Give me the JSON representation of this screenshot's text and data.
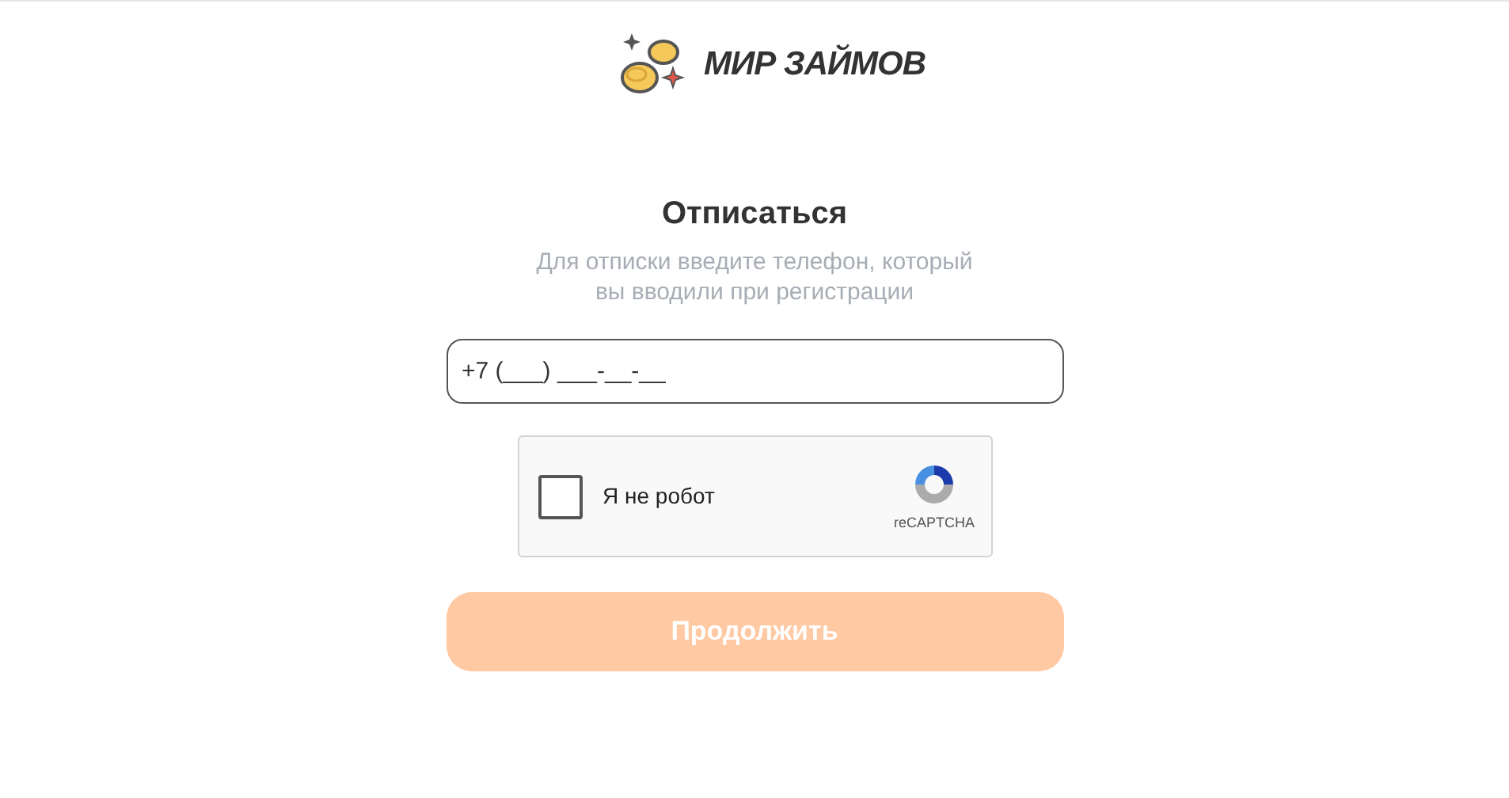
{
  "logo": {
    "text": "МИР ЗАЙМОВ"
  },
  "title": "Отписаться",
  "subtitle": [
    "Для отписки введите телефон, который",
    "вы вводили при регистрации"
  ],
  "phone_field": {
    "value": "+7 (___) ___-__-__"
  },
  "captcha": {
    "label": "Я не робот",
    "checked": false,
    "brand": "reCAPTCHA"
  },
  "submit_button": {
    "label": "Продолжить",
    "disabled": true
  }
}
